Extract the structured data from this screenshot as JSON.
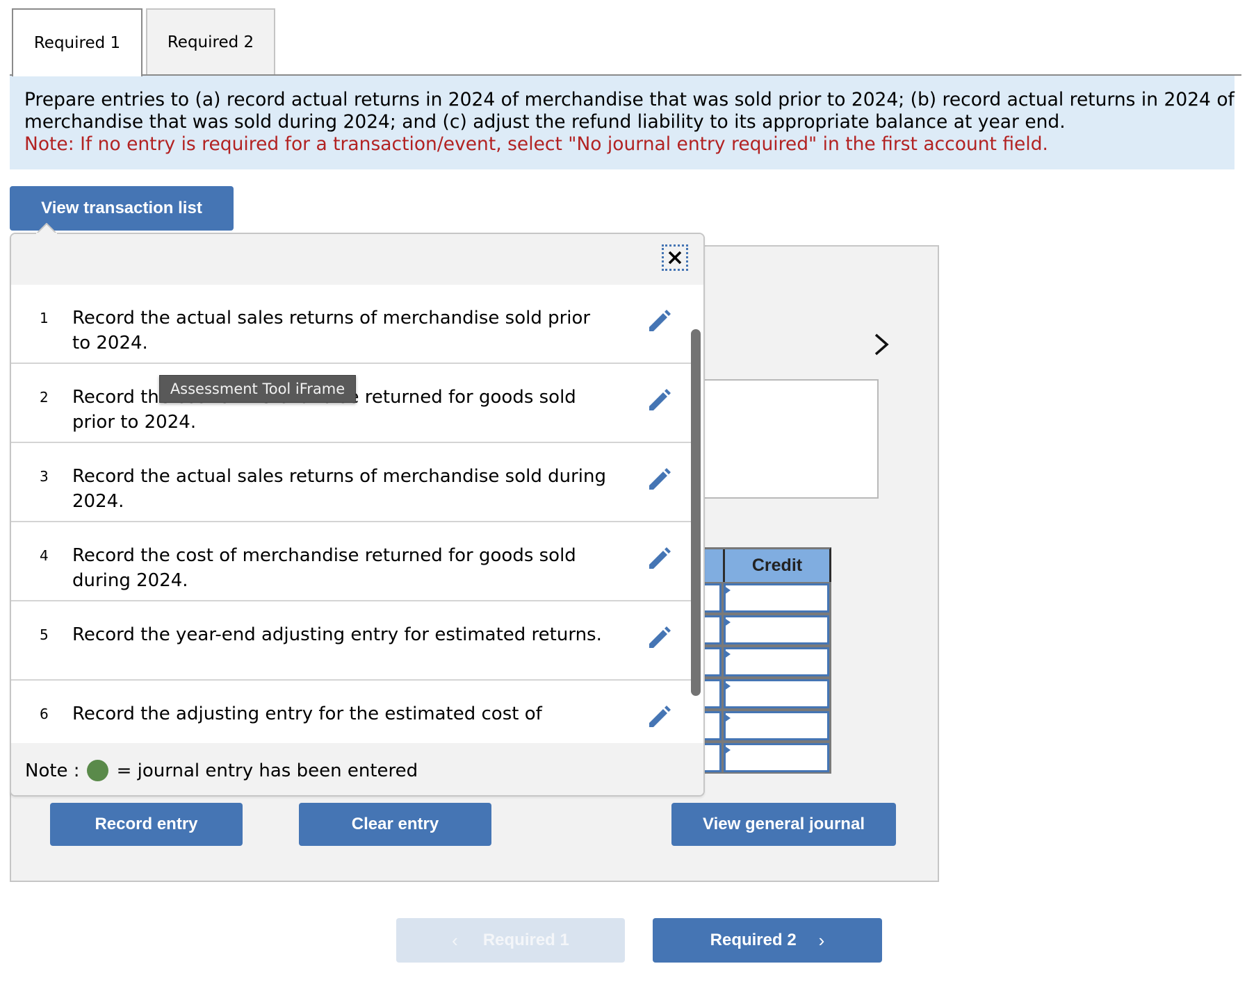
{
  "tabs": [
    {
      "label": "Required 1",
      "active": true
    },
    {
      "label": "Required 2",
      "active": false
    }
  ],
  "instructions": {
    "line1": "Prepare entries to (a) record actual returns in 2024 of merchandise that was sold prior to 2024; (b) record actual returns in 2024 of",
    "line2": "merchandise that was sold during 2024; and (c) adjust the refund liability to its appropriate balance at year end.",
    "note": "Note: If no entry is required for a transaction/event, select \"No journal entry required\" in the first account field."
  },
  "buttons": {
    "view_transaction_list": "View transaction list",
    "record_entry": "Record entry",
    "clear_entry": "Clear entry",
    "view_general_journal": "View general journal"
  },
  "transaction_list": {
    "items": [
      {
        "num": "1",
        "text": "Record the actual sales returns of merchandise sold prior to 2024."
      },
      {
        "num": "2",
        "text": "Record the cost of merchandise returned for goods sold prior to 2024."
      },
      {
        "num": "3",
        "text": "Record the actual sales returns of merchandise sold during 2024."
      },
      {
        "num": "4",
        "text": "Record the cost of merchandise returned for goods sold during 2024."
      },
      {
        "num": "5",
        "text": "Record the year-end adjusting entry for estimated returns."
      },
      {
        "num": "6",
        "text": "Record the adjusting entry for the estimated cost of"
      }
    ],
    "note_label": "Note :",
    "note_text": "= journal entry has been entered",
    "entered_color": "#5a8a4a"
  },
  "tooltip": "Assessment Tool iFrame",
  "journal": {
    "credit_header": "Credit",
    "row_count": 6
  },
  "nav": {
    "prev_label": "Required 1",
    "next_label": "Required 2",
    "prev_chevron": "‹",
    "next_chevron": "›"
  },
  "colors": {
    "accent": "#4575b4",
    "instruction_bg": "#ddebf7",
    "note_red": "#b22222",
    "header_blue": "#80ade0"
  }
}
